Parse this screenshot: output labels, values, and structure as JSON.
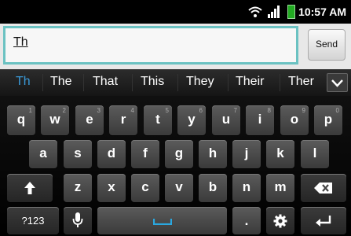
{
  "status_bar": {
    "time": "10:57 AM"
  },
  "compose": {
    "text": "Th",
    "send_label": "Send"
  },
  "suggestions": [
    "Th",
    "The",
    "That",
    "This",
    "They",
    "Their",
    "Ther"
  ],
  "keyboard": {
    "row1": [
      {
        "label": "q",
        "sub": "1"
      },
      {
        "label": "w",
        "sub": "2"
      },
      {
        "label": "e",
        "sub": "3"
      },
      {
        "label": "r",
        "sub": "4"
      },
      {
        "label": "t",
        "sub": "5"
      },
      {
        "label": "y",
        "sub": "6"
      },
      {
        "label": "u",
        "sub": "7"
      },
      {
        "label": "i",
        "sub": "8"
      },
      {
        "label": "o",
        "sub": "9"
      },
      {
        "label": "p",
        "sub": "0"
      }
    ],
    "row2": [
      "a",
      "s",
      "d",
      "f",
      "g",
      "h",
      "j",
      "k",
      "l"
    ],
    "row3": [
      "z",
      "x",
      "c",
      "v",
      "b",
      "n",
      "m"
    ],
    "symbols_label": "?123",
    "period_label": "."
  },
  "colors": {
    "accent": "#6bc2c2",
    "suggestion_highlight": "#3a9ad9"
  }
}
